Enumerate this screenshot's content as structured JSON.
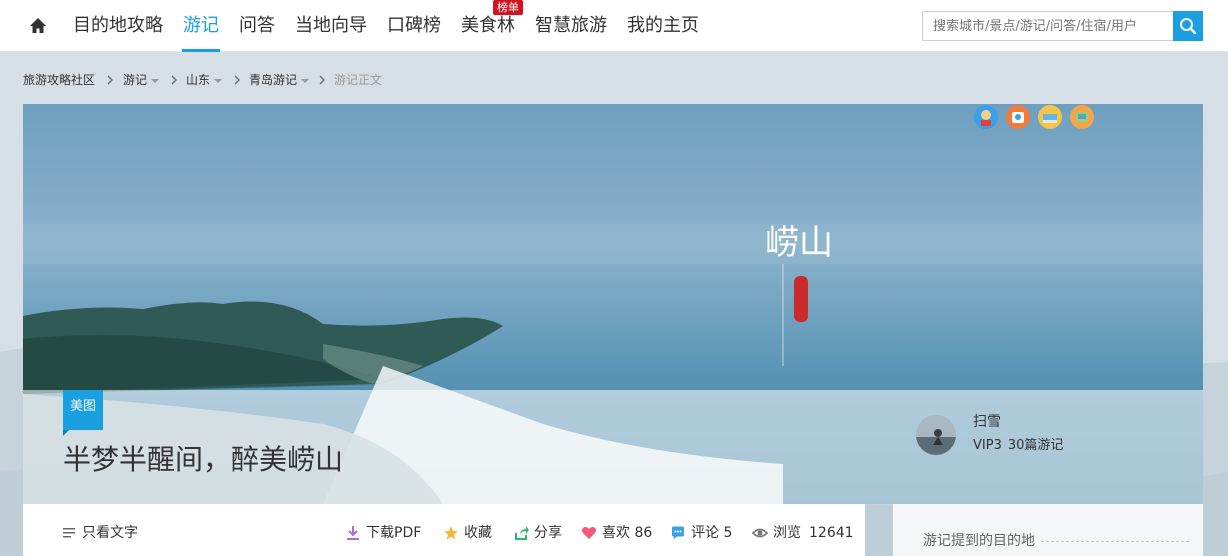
{
  "colors": {
    "accent": "#1aa0e0",
    "badge": "#d0141f",
    "tag": "#1aa0e0"
  },
  "nav": {
    "home_icon": "home-icon",
    "items": [
      {
        "label": "目的地攻略"
      },
      {
        "label": "游记"
      },
      {
        "label": "问答"
      },
      {
        "label": "当地向导"
      },
      {
        "label": "口碑榜"
      },
      {
        "label": "美食林"
      },
      {
        "label": "智慧旅游"
      },
      {
        "label": "我的主页"
      }
    ],
    "active_index": 1,
    "badge": "榜单"
  },
  "search": {
    "placeholder": "搜索城市/景点/游记/问答/住宿/用户",
    "icon": "search-icon"
  },
  "breadcrumb": {
    "items": [
      {
        "label": "旅游攻略社区"
      },
      {
        "label": "游记"
      },
      {
        "label": "山东"
      },
      {
        "label": "青岛游记"
      },
      {
        "label": "游记正文"
      }
    ]
  },
  "hero": {
    "calligraphy": "崂山",
    "tag": "美图",
    "title": "半梦半醒间，醉美崂山"
  },
  "author": {
    "name": "扫雪",
    "level": "VIP3",
    "count": "30篇游记",
    "medals": [
      "medal-icon",
      "medal-icon",
      "medal-icon",
      "medal-icon"
    ]
  },
  "actions": {
    "text_only": "只看文字",
    "download": "下载PDF",
    "favorite": "收藏",
    "share": "分享",
    "like": "喜欢 86",
    "comment": "评论 5",
    "views_label": "浏览",
    "views_count": "12641"
  },
  "sidebar": {
    "title": "游记提到的目的地"
  }
}
